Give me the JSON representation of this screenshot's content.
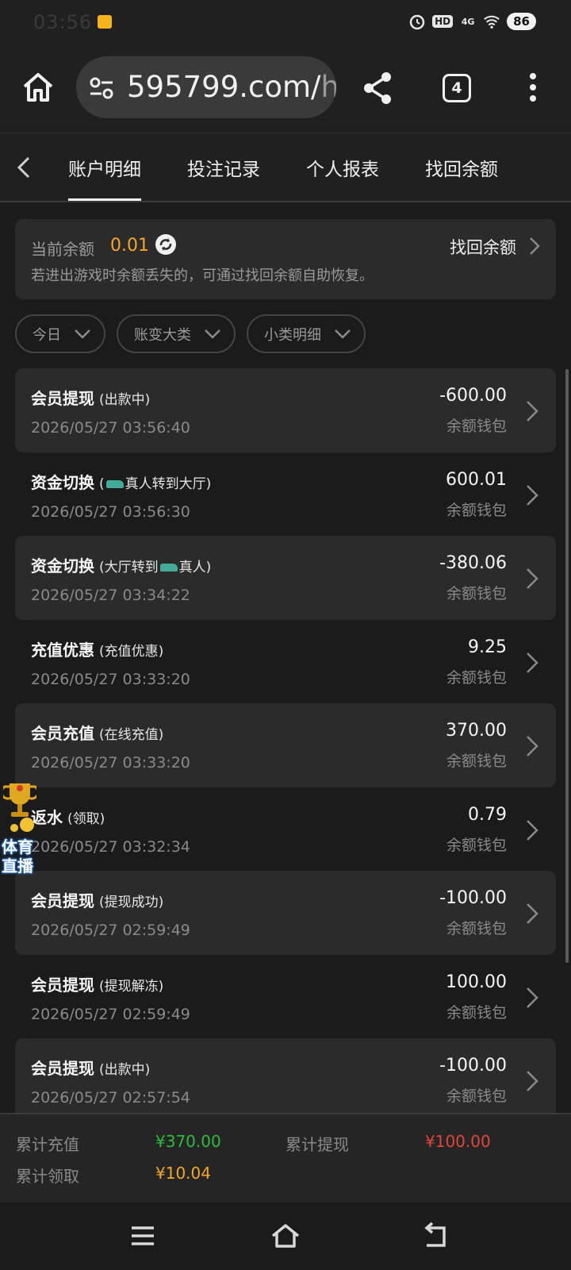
{
  "status_bar": {
    "time": "03:56",
    "network": "4G",
    "hd": "HD",
    "battery": "86",
    "icons": [
      "mail-icon",
      "alarm-icon",
      "hd-icon",
      "signal-icon",
      "wifi-icon",
      "battery-icon"
    ]
  },
  "browser": {
    "url_main": "595799.com/",
    "url_tail": "h",
    "tab_count": "4"
  },
  "tabs": [
    {
      "label": "账户明细",
      "active": true
    },
    {
      "label": "投注记录"
    },
    {
      "label": "个人报表"
    },
    {
      "label": "找回余额"
    }
  ],
  "balance": {
    "label": "当前余额",
    "value": "0.01",
    "recover_label": "找回余额",
    "tip": "若进出游戏时余额丢失的，可通过找回余额自助恢复。"
  },
  "filters": [
    {
      "label": "今日"
    },
    {
      "label": "账变大类"
    },
    {
      "label": "小类明细"
    }
  ],
  "records": [
    {
      "title": "会员提现",
      "sub": "(出款中)",
      "time": "2026/05/27 03:56:40",
      "amount": "-600.00",
      "wallet": "余额钱包"
    },
    {
      "title": "资金切换",
      "sub_pre": "(",
      "sub": "真人转到大厅)",
      "car_pos": "before",
      "time": "2026/05/27 03:56:30",
      "amount": "600.01",
      "wallet": "余额钱包"
    },
    {
      "title": "资金切换",
      "sub": "(大厅转到",
      "sub_post": "真人)",
      "car_pos": "middle",
      "time": "2026/05/27 03:34:22",
      "amount": "-380.06",
      "wallet": "余额钱包"
    },
    {
      "title": "充值优惠",
      "sub": "(充值优惠)",
      "time": "2026/05/27 03:33:20",
      "amount": "9.25",
      "wallet": "余额钱包"
    },
    {
      "title": "会员充值",
      "sub": "(在线充值)",
      "time": "2026/05/27 03:33:20",
      "amount": "370.00",
      "wallet": "余额钱包"
    },
    {
      "title": "返水",
      "sub": "(领取)",
      "time": "2026/05/27 03:32:34",
      "amount": "0.79",
      "wallet": "余额钱包"
    },
    {
      "title": "会员提现",
      "sub": "(提现成功)",
      "time": "2026/05/27 02:59:49",
      "amount": "-100.00",
      "wallet": "余额钱包"
    },
    {
      "title": "会员提现",
      "sub": "(提现解冻)",
      "time": "2026/05/27 02:59:49",
      "amount": "100.00",
      "wallet": "余额钱包"
    },
    {
      "title": "会员提现",
      "sub": "(出款中)",
      "time": "2026/05/27 02:57:54",
      "amount": "-100.00",
      "wallet": "余额钱包"
    }
  ],
  "float_badge": {
    "line1": "体育",
    "line2": "直播"
  },
  "summary": {
    "deposit_label": "累计充值",
    "deposit_value": "¥370.00",
    "withdraw_label": "累计提现",
    "withdraw_value": "¥100.00",
    "claim_label": "累计领取",
    "claim_value": "¥10.04",
    "colors": {
      "deposit": "#2dbb3c",
      "withdraw": "#e0463c",
      "claim": "#f5a623"
    }
  }
}
